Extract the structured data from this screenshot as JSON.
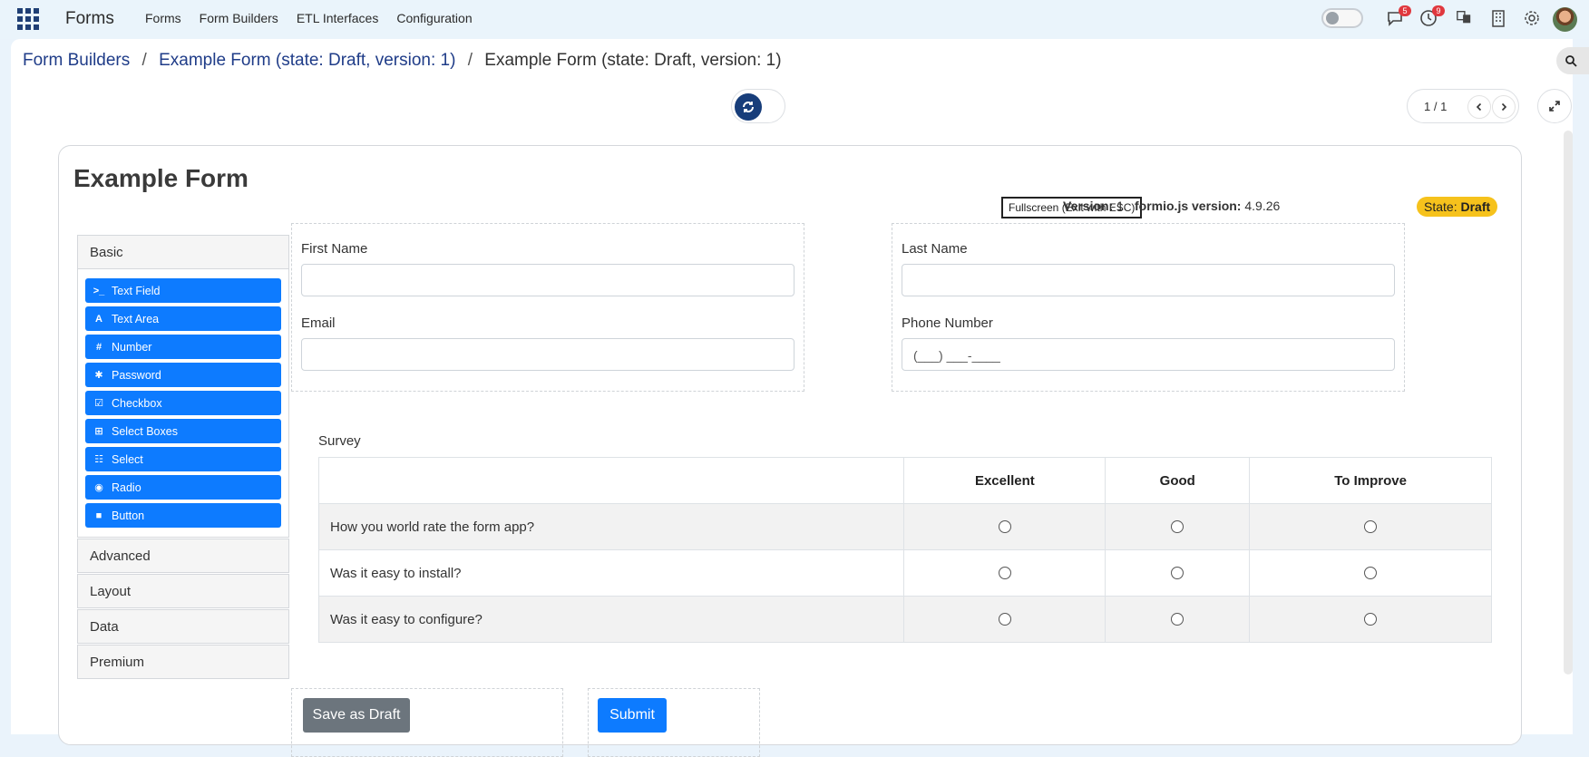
{
  "app": {
    "title": "Forms"
  },
  "nav": [
    "Forms",
    "Form Builders",
    "ETL Interfaces",
    "Configuration"
  ],
  "header_badges": {
    "chat": "5",
    "clock": "9"
  },
  "breadcrumb": {
    "items": [
      "Form Builders",
      "Example Form (state: Draft, version: 1)"
    ],
    "current": "Example Form (state: Draft, version: 1)",
    "separator": "/"
  },
  "pager": {
    "text": "1 / 1"
  },
  "form": {
    "title": "Example Form",
    "fullscreen_label": "Fullscreen (Exit with ESC)",
    "version_label": "Version:",
    "version_value": "1",
    "formio_label": "formio.js version:",
    "formio_value": "4.9.26",
    "state_label": "State:",
    "state_value": "Draft"
  },
  "components": {
    "groups": [
      "Basic",
      "Advanced",
      "Layout",
      "Data",
      "Premium"
    ],
    "basic": [
      {
        "icon": "terminal-icon",
        "glyph": ">_",
        "label": "Text Field"
      },
      {
        "icon": "font-icon",
        "glyph": "A",
        "label": "Text Area"
      },
      {
        "icon": "hashtag-icon",
        "glyph": "#",
        "label": "Number"
      },
      {
        "icon": "asterisk-icon",
        "glyph": "✱",
        "label": "Password"
      },
      {
        "icon": "check-square-icon",
        "glyph": "☑",
        "label": "Checkbox"
      },
      {
        "icon": "plus-square-icon",
        "glyph": "⊞",
        "label": "Select Boxes"
      },
      {
        "icon": "th-list-icon",
        "glyph": "☷",
        "label": "Select"
      },
      {
        "icon": "dot-circle-icon",
        "glyph": "◉",
        "label": "Radio"
      },
      {
        "icon": "stop-icon",
        "glyph": "■",
        "label": "Button"
      }
    ]
  },
  "fields": {
    "first_name": {
      "label": "First Name",
      "value": ""
    },
    "last_name": {
      "label": "Last Name",
      "value": ""
    },
    "email": {
      "label": "Email",
      "value": ""
    },
    "phone": {
      "label": "Phone Number",
      "placeholder": "(___) ___-____"
    }
  },
  "survey": {
    "label": "Survey",
    "columns": [
      "Excellent",
      "Good",
      "To Improve"
    ],
    "questions": [
      "How you world rate the form app?",
      "Was it easy to install?",
      "Was it easy to configure?"
    ]
  },
  "buttons": {
    "save_draft": "Save as Draft",
    "submit": "Submit"
  },
  "colors": {
    "primary": "#0d7bff",
    "navy": "#173d7a",
    "state_badge": "#f6c21c",
    "secondary": "#6c757d"
  }
}
